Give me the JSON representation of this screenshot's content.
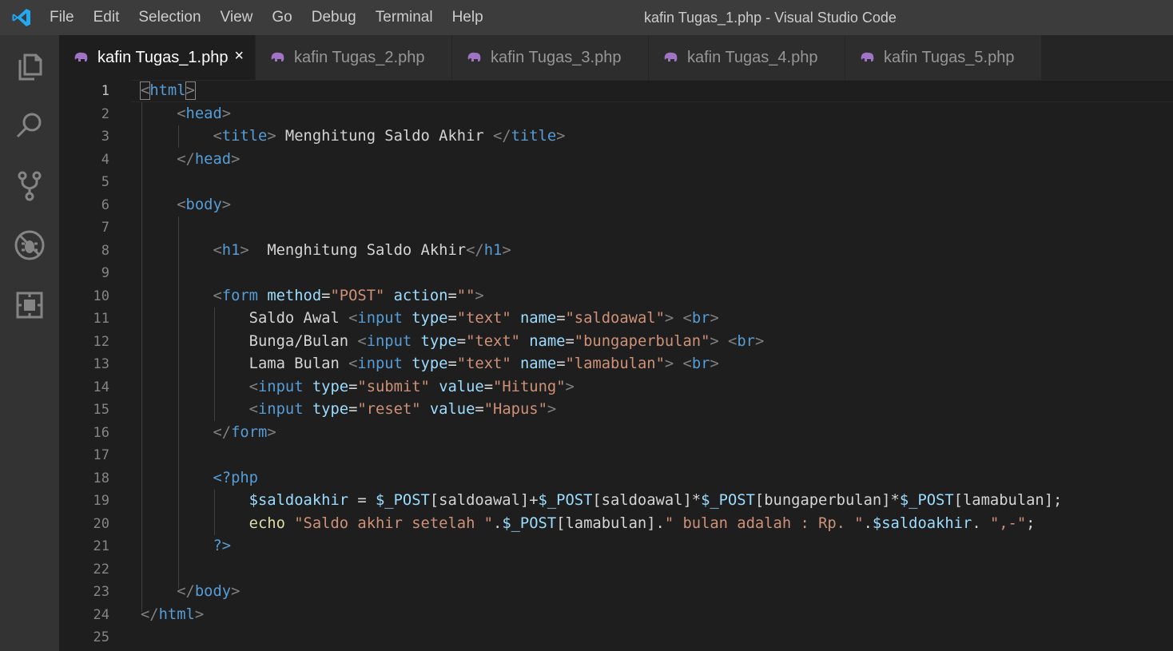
{
  "titlebar": {
    "menu": [
      "File",
      "Edit",
      "Selection",
      "View",
      "Go",
      "Debug",
      "Terminal",
      "Help"
    ],
    "window_title": "kafin Tugas_1.php - Visual Studio Code"
  },
  "activitybar": {
    "icons": [
      "explorer-icon",
      "search-icon",
      "source-control-icon",
      "debug-icon",
      "extensions-icon"
    ]
  },
  "tabs": [
    {
      "label": "kafin Tugas_1.php",
      "active": true,
      "close": "×"
    },
    {
      "label": "kafin Tugas_2.php",
      "active": false
    },
    {
      "label": "kafin Tugas_3.php",
      "active": false
    },
    {
      "label": "kafin Tugas_4.php",
      "active": false
    },
    {
      "label": "kafin Tugas_5.php",
      "active": false
    }
  ],
  "editor": {
    "current_line": 1,
    "line_numbers": [
      "1",
      "2",
      "3",
      "4",
      "5",
      "6",
      "7",
      "8",
      "9",
      "10",
      "11",
      "12",
      "13",
      "14",
      "15",
      "16",
      "17",
      "18",
      "19",
      "20",
      "21",
      "22",
      "23",
      "24",
      "25"
    ],
    "lines": [
      [
        [
          "br",
          "<"
        ],
        [
          "tag",
          "html"
        ],
        [
          "br",
          ">"
        ]
      ],
      [
        [
          "br",
          "    <"
        ],
        [
          "tag",
          "head"
        ],
        [
          "br",
          ">"
        ]
      ],
      [
        [
          "br",
          "        <"
        ],
        [
          "tag",
          "title"
        ],
        [
          "br",
          ">"
        ],
        [
          "txt",
          " Menghitung Saldo Akhir "
        ],
        [
          "br",
          "</"
        ],
        [
          "tag",
          "title"
        ],
        [
          "br",
          ">"
        ]
      ],
      [
        [
          "br",
          "    </"
        ],
        [
          "tag",
          "head"
        ],
        [
          "br",
          ">"
        ]
      ],
      [],
      [
        [
          "br",
          "    <"
        ],
        [
          "tag",
          "body"
        ],
        [
          "br",
          ">"
        ]
      ],
      [],
      [
        [
          "br",
          "        <"
        ],
        [
          "tag",
          "h1"
        ],
        [
          "br",
          ">"
        ],
        [
          "txt",
          "  Menghitung Saldo Akhir"
        ],
        [
          "br",
          "</"
        ],
        [
          "tag",
          "h1"
        ],
        [
          "br",
          ">"
        ]
      ],
      [],
      [
        [
          "br",
          "        <"
        ],
        [
          "tag",
          "form"
        ],
        [
          "txt",
          " "
        ],
        [
          "attr",
          "method"
        ],
        [
          "txt",
          "="
        ],
        [
          "str",
          "\"POST\""
        ],
        [
          "txt",
          " "
        ],
        [
          "attr",
          "action"
        ],
        [
          "txt",
          "="
        ],
        [
          "str",
          "\"\""
        ],
        [
          "br",
          ">"
        ]
      ],
      [
        [
          "txt",
          "            Saldo Awal "
        ],
        [
          "br",
          "<"
        ],
        [
          "tag",
          "input"
        ],
        [
          "txt",
          " "
        ],
        [
          "attr",
          "type"
        ],
        [
          "txt",
          "="
        ],
        [
          "str",
          "\"text\""
        ],
        [
          "txt",
          " "
        ],
        [
          "attr",
          "name"
        ],
        [
          "txt",
          "="
        ],
        [
          "str",
          "\"saldoawal\""
        ],
        [
          "br",
          ">"
        ],
        [
          "txt",
          " "
        ],
        [
          "br",
          "<"
        ],
        [
          "tag",
          "br"
        ],
        [
          "br",
          ">"
        ]
      ],
      [
        [
          "txt",
          "            Bunga/Bulan "
        ],
        [
          "br",
          "<"
        ],
        [
          "tag",
          "input"
        ],
        [
          "txt",
          " "
        ],
        [
          "attr",
          "type"
        ],
        [
          "txt",
          "="
        ],
        [
          "str",
          "\"text\""
        ],
        [
          "txt",
          " "
        ],
        [
          "attr",
          "name"
        ],
        [
          "txt",
          "="
        ],
        [
          "str",
          "\"bungaperbulan\""
        ],
        [
          "br",
          ">"
        ],
        [
          "txt",
          " "
        ],
        [
          "br",
          "<"
        ],
        [
          "tag",
          "br"
        ],
        [
          "br",
          ">"
        ]
      ],
      [
        [
          "txt",
          "            Lama Bulan "
        ],
        [
          "br",
          "<"
        ],
        [
          "tag",
          "input"
        ],
        [
          "txt",
          " "
        ],
        [
          "attr",
          "type"
        ],
        [
          "txt",
          "="
        ],
        [
          "str",
          "\"text\""
        ],
        [
          "txt",
          " "
        ],
        [
          "attr",
          "name"
        ],
        [
          "txt",
          "="
        ],
        [
          "str",
          "\"lamabulan\""
        ],
        [
          "br",
          ">"
        ],
        [
          "txt",
          " "
        ],
        [
          "br",
          "<"
        ],
        [
          "tag",
          "br"
        ],
        [
          "br",
          ">"
        ]
      ],
      [
        [
          "br",
          "            <"
        ],
        [
          "tag",
          "input"
        ],
        [
          "txt",
          " "
        ],
        [
          "attr",
          "type"
        ],
        [
          "txt",
          "="
        ],
        [
          "str",
          "\"submit\""
        ],
        [
          "txt",
          " "
        ],
        [
          "attr",
          "value"
        ],
        [
          "txt",
          "="
        ],
        [
          "str",
          "\"Hitung\""
        ],
        [
          "br",
          ">"
        ]
      ],
      [
        [
          "br",
          "            <"
        ],
        [
          "tag",
          "input"
        ],
        [
          "txt",
          " "
        ],
        [
          "attr",
          "type"
        ],
        [
          "txt",
          "="
        ],
        [
          "str",
          "\"reset\""
        ],
        [
          "txt",
          " "
        ],
        [
          "attr",
          "value"
        ],
        [
          "txt",
          "="
        ],
        [
          "str",
          "\"Hapus\""
        ],
        [
          "br",
          ">"
        ]
      ],
      [
        [
          "br",
          "        </"
        ],
        [
          "tag",
          "form"
        ],
        [
          "br",
          ">"
        ]
      ],
      [],
      [
        [
          "tag",
          "        <?php"
        ]
      ],
      [
        [
          "var",
          "            $saldoakhir"
        ],
        [
          "txt",
          " = "
        ],
        [
          "var",
          "$_POST"
        ],
        [
          "txt",
          "[saldoawal]+"
        ],
        [
          "var",
          "$_POST"
        ],
        [
          "txt",
          "[saldoawal]*"
        ],
        [
          "var",
          "$_POST"
        ],
        [
          "txt",
          "[bungaperbulan]*"
        ],
        [
          "var",
          "$_POST"
        ],
        [
          "txt",
          "[lamabulan];"
        ]
      ],
      [
        [
          "fn",
          "            echo"
        ],
        [
          "txt",
          " "
        ],
        [
          "str",
          "\"Saldo akhir setelah \""
        ],
        [
          "txt",
          "."
        ],
        [
          "var",
          "$_POST"
        ],
        [
          "txt",
          "[lamabulan]."
        ],
        [
          "str",
          "\" bulan adalah : Rp. \""
        ],
        [
          "txt",
          "."
        ],
        [
          "var",
          "$saldoakhir"
        ],
        [
          "txt",
          ". "
        ],
        [
          "str",
          "\",-\""
        ],
        [
          "txt",
          ";"
        ]
      ],
      [
        [
          "tag",
          "        ?>"
        ]
      ],
      [],
      [
        [
          "br",
          "    </"
        ],
        [
          "tag",
          "body"
        ],
        [
          "br",
          ">"
        ]
      ],
      [
        [
          "br",
          "</"
        ],
        [
          "tag",
          "html"
        ],
        [
          "br",
          ">"
        ]
      ],
      []
    ]
  }
}
